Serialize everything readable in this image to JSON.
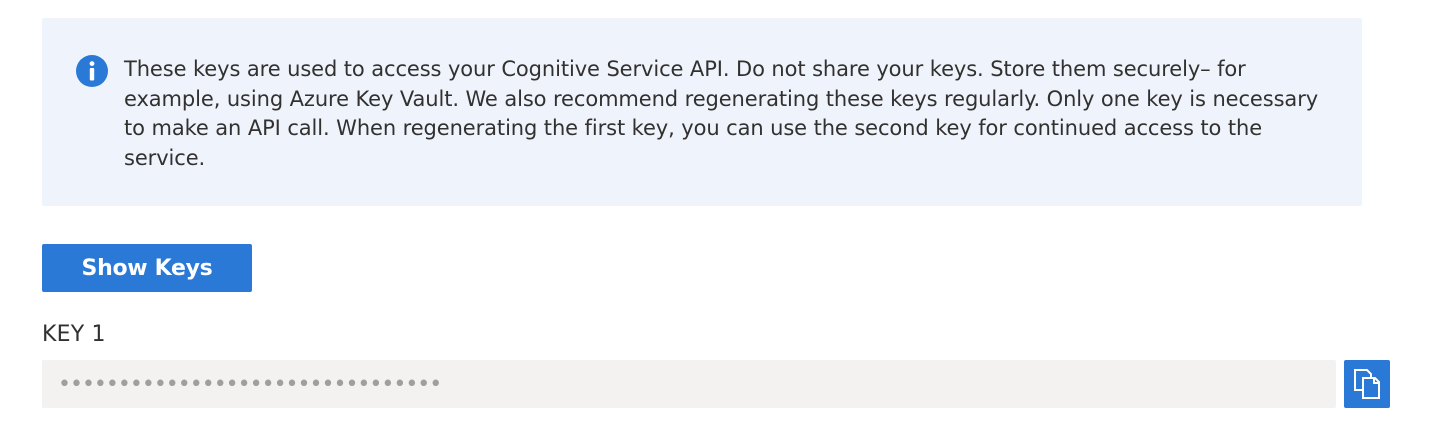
{
  "info": {
    "icon": "info-icon",
    "message": "These keys are used to access your Cognitive Service API. Do not share your keys. Store them securely– for example, using Azure Key Vault. We also recommend regenerating these keys regularly. Only one key is necessary to make an API call. When regenerating the first key, you can use the second key for continued access to the service."
  },
  "show_keys_button": {
    "label": "Show Keys"
  },
  "key1": {
    "label": "KEY 1",
    "value": "••••••••••••••••••••••••••••••••",
    "copy_icon": "copy-icon"
  },
  "colors": {
    "banner_background": "#eff4fc",
    "accent": "#2b79d6",
    "input_background": "#f3f2f1",
    "text": "#323130"
  }
}
